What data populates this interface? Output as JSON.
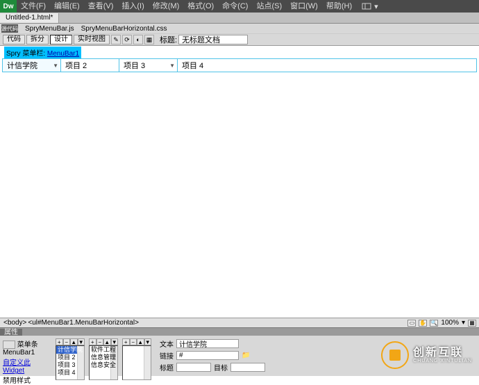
{
  "app": {
    "logo": "Dw"
  },
  "menubar_top": [
    "文件(F)",
    "编辑(E)",
    "查看(V)",
    "插入(I)",
    "修改(M)",
    "格式(O)",
    "命令(C)",
    "站点(S)",
    "窗口(W)",
    "帮助(H)"
  ],
  "layout_label": "",
  "doc_tab": "Untitled-1.html*",
  "related_files": [
    "源代码",
    "SpryMenuBar.js",
    "SpryMenuBarHorizontal.css"
  ],
  "view_buttons": {
    "code": "代码",
    "split": "拆分",
    "design": "设计",
    "live": "实时视图"
  },
  "title_label": "标题:",
  "title_value": "无标题文档",
  "spry_tag": {
    "prefix": "Spry 菜单栏:",
    "id": "MenuBar1"
  },
  "menu_items": [
    "计信学院",
    "项目 2",
    "项目 3",
    "项目 4"
  ],
  "tag_path": [
    "<body>",
    "<ul#MenuBar1.MenuBarHorizontal>"
  ],
  "zoom": "100%",
  "props": {
    "header": "属性",
    "widget_label": "菜单条",
    "widget_name": "MenuBar1",
    "customize": "自定义此 Widget",
    "disable_styles": "禁用样式",
    "list1": [
      "计信学院",
      "项目 2",
      "项目 3",
      "项目 4"
    ],
    "list2": [
      "软件工程",
      "信息管理",
      "信息安全"
    ],
    "text_label": "文本",
    "text_value": "计信学院",
    "link_label": "链接",
    "link_value": "#",
    "title2_label": "标题",
    "title2_value": "",
    "target_label": "目标",
    "target_value": ""
  },
  "watermark": {
    "big": "创新互联",
    "small": "CHUANG XINTULIAN"
  }
}
